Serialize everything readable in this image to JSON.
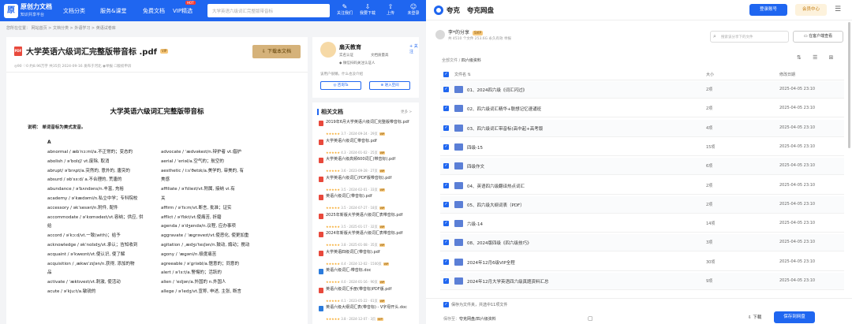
{
  "left": {
    "logo": {
      "mark": "原",
      "name": "原创力文档",
      "sub": "知识共享平台"
    },
    "nav": [
      "文档分类",
      "服务&课堂",
      "免费文档",
      "VIP精选"
    ],
    "hot": "HOT",
    "search_placeholder": "大学英语六级词汇完整版带音标",
    "nav_icons": [
      {
        "icon": "✎",
        "label": "关注我们"
      },
      {
        "icon": "⇩",
        "label": "我要下载"
      },
      {
        "icon": "⇧",
        "label": "上传"
      },
      {
        "icon": "☺",
        "label": "未登录"
      }
    ],
    "breadcrumb": "您所在位置： 网站首页 > 文档分类 > 外语学习 > 英语试卷库",
    "doc": {
      "title": "大学英语六级词汇完整版带音标 .pdf",
      "vip": "VIP",
      "download": "下载本文档",
      "meta": "◎90   ♡0   约8.96万字   共35页   2024-09-16 发布于河北   ◉举报   ☐版权申诉",
      "page_title": "大学英语六级词汇完整版带音标",
      "note": "说明： 单词音标为美式发音。",
      "section": "A",
      "col1": [
        "abnormal / æbˈnɔːml/a.不正常的；变态的",
        "abolish / əˈbɑlɪʃ/ vt.废除, 取消",
        "abrupt/ əˈbrʌpt/a.突然的, 意外的, 唐突的",
        "absurd / əbˈsɜːd/ a.不合理的, 荒唐的",
        "abundance / əˈbʌndəns/n.丰富, 充裕",
        "academy / əˈkædəmi/n.私立中学；专科院校",
        "accessory / əkˈsesəri/n.附件, 配件",
        "accommodate / əˈkɑmədeɪt/vt.容纳；供应, 供",
        "给",
        "accord / əˈkɔːd/vt.一致(with)；给予",
        "acknowledge / əkˈnɑlɪdʒ/vt.承认；告知收到",
        "acquaint / əˈkweɪnt/vt.使认识, 使了解",
        "acquisition / ˌækwɪˈzɪʃən/n.获得, 添加的物",
        "品",
        "activate / ˈæktɪveɪt/vt.刺激, 使活动",
        "acute / əˈkjuːt/a.敏锐的"
      ],
      "col2": [
        "advocate / ˈædvəkeɪt/n.辩护者 vt.倡护",
        "aerial / ˈeriəl/a.空气的；航空的",
        "aesthetic / iːsˈθetɪk/a.美学的, 审美的, 有",
        "美感",
        "affiliate / əˈfɪlieɪt/vt.附属, 接纳 vi.有",
        "关",
        "affirm / əˈfɜːm/vt.断言, 批准；证实",
        "afflict / əˈflɪkt/vt.使痛苦, 折磨",
        "agenda / əˈdʒendə/n.议程, 应办事项",
        "aggravate / ˈæɡrəveɪt/vt.使恶化, 使更加重",
        "agitation / ˌædʒɪˈteɪʃən/n.鼓动, 煽动；搅动",
        "agony / ˈæɡəni/n.极度痛苦",
        "agreeable / əˈɡriəbl/a.惬意的；同意的",
        "alert / əˈlɜːt/a.警惕的；活跃的",
        "alien / ˈeɪljən/a.外国的 n.外国人",
        "allege / əˈledʒ/vt.宣称, 申述, 主张, 断言"
      ]
    },
    "author": {
      "name": "扇天教育",
      "follow": "+ 关注",
      "badges": [
        "实名认证",
        "文档质量高"
      ],
      "badge3": "◆ 微信扫码关注认证人",
      "intro": "该用户很懒，什么也没介绍",
      "btn1": "◎ 咨询Ta",
      "btn2": "⊕ 进入空间"
    },
    "related": {
      "header": "相关文档",
      "more": "更多 >",
      "items": [
        {
          "title": "2019年6月大学英语六级词汇完整版带音标.pdf",
          "stars": "★★★★★",
          "score": "3.7",
          "date": "2024-09-24 · 29页",
          "type": "pdf"
        },
        {
          "title": "大学英语六级词汇带音标.pdf",
          "stars": "★★★★★",
          "score": "4.3",
          "date": "2024-01-02 · 25页",
          "type": "pdf"
        },
        {
          "title": "大学英语六级高频600词汇(带音标).pdf",
          "stars": "★★★★★",
          "score": "3.6",
          "date": "2023-09-28 · 27页",
          "type": "pdf"
        },
        {
          "title": "大学英语六级词汇(PDF版带音标).pdf",
          "stars": "★★★★★",
          "score": "3.5",
          "date": "2024-02-01 · 33页",
          "type": "pdf"
        },
        {
          "title": "英语六级词汇(带音标).pdf",
          "stars": "★★★★★",
          "score": "3.5",
          "date": "2024-07-27 · 18页",
          "type": "pdf"
        },
        {
          "title": "2025年新版大学英语六级词汇表带音标.pdf",
          "stars": "★★★★★",
          "score": "3.5",
          "date": "2025-01-17 · 32页",
          "type": "pdf"
        },
        {
          "title": "2024年新版大学英语六级词汇表带音标.pdf",
          "stars": "★★★★★",
          "score": "3.8",
          "date": "2025-01-08 · 35页",
          "type": "pdf"
        },
        {
          "title": "大学英语四级词汇(带音标).pdf",
          "stars": "★★★★★",
          "score": "4.4",
          "date": "2024-12-02 · 1500页",
          "type": "pdf"
        },
        {
          "title": "英语六级词汇-带音标.doc",
          "stars": "★★★★★",
          "score": "4.0",
          "date": "2024-01-16 · 90页",
          "type": "doc"
        },
        {
          "title": "英语六级词汇手册(带音标)PDF版.pdf",
          "stars": "★★★★★",
          "score": "4.1",
          "date": "2023-05-22 · 61页",
          "type": "pdf"
        },
        {
          "title": "英语六级大纲词汇表(带音标) - V字母开头.doc",
          "stars": "★★★★★",
          "score": "3.8",
          "date": "2024-12-07 · 3页",
          "type": "doc"
        }
      ]
    }
  },
  "right": {
    "brand": "夸克",
    "product": "夸克网盘",
    "login": "登录账号",
    "vip": "会员中心",
    "menu": "☰",
    "user": {
      "name": "李*的分享",
      "badge": "SVIP",
      "sub": "共 4510 个文件 253.6G   永久有效   举报"
    },
    "search_placeholder": "搜索该分享下的文件",
    "open_pc": "在客户端查看",
    "path": [
      "全部文件",
      "四六级资料"
    ],
    "view_icons": "⇅ ☰ ⊞",
    "columns": {
      "name": "文件名 ⇅",
      "size": "大小",
      "date": "修改日期"
    },
    "files": [
      {
        "name": "01、2024四六级《词汇闪过》",
        "size": "2项",
        "date": "2025-04-05 23:10"
      },
      {
        "name": "02、四六级词汇精华+联想记忆速诵班",
        "size": "2项",
        "date": "2025-04-05 23:10"
      },
      {
        "name": "03、四六级词汇带音标(高中起+高考版",
        "size": "4项",
        "date": "2025-04-05 23:10"
      },
      {
        "name": "四级-15",
        "size": "15项",
        "date": "2025-04-05 23:10"
      },
      {
        "name": "四级作文",
        "size": "6项",
        "date": "2025-04-05 23:10"
      },
      {
        "name": "04、英语四六级翻译热点词汇",
        "size": "2项",
        "date": "2025-04-05 23:10"
      },
      {
        "name": "05、四六级大纲词表（PDF）",
        "size": "2项",
        "date": "2025-04-05 23:10"
      },
      {
        "name": "六级-14",
        "size": "14项",
        "date": "2025-04-05 23:10"
      },
      {
        "name": "08、2024版四级《四六级技巧》",
        "size": "3项",
        "date": "2025-04-05 23:10"
      },
      {
        "name": "2024年12月6级VIP全程",
        "size": "30项",
        "date": "2025-04-05 23:10"
      },
      {
        "name": "2024年12月大学英语四六级真题资料汇总",
        "size": "9项",
        "date": "2025-04-05 23:10"
      }
    ],
    "save_to": "保存为文件夹，共选中11项文件",
    "save_loc_label": "保存至：",
    "save_loc": "夸克网盘/四六级资料",
    "download": "⇩ 下载",
    "save_btn": "保存到网盘"
  }
}
